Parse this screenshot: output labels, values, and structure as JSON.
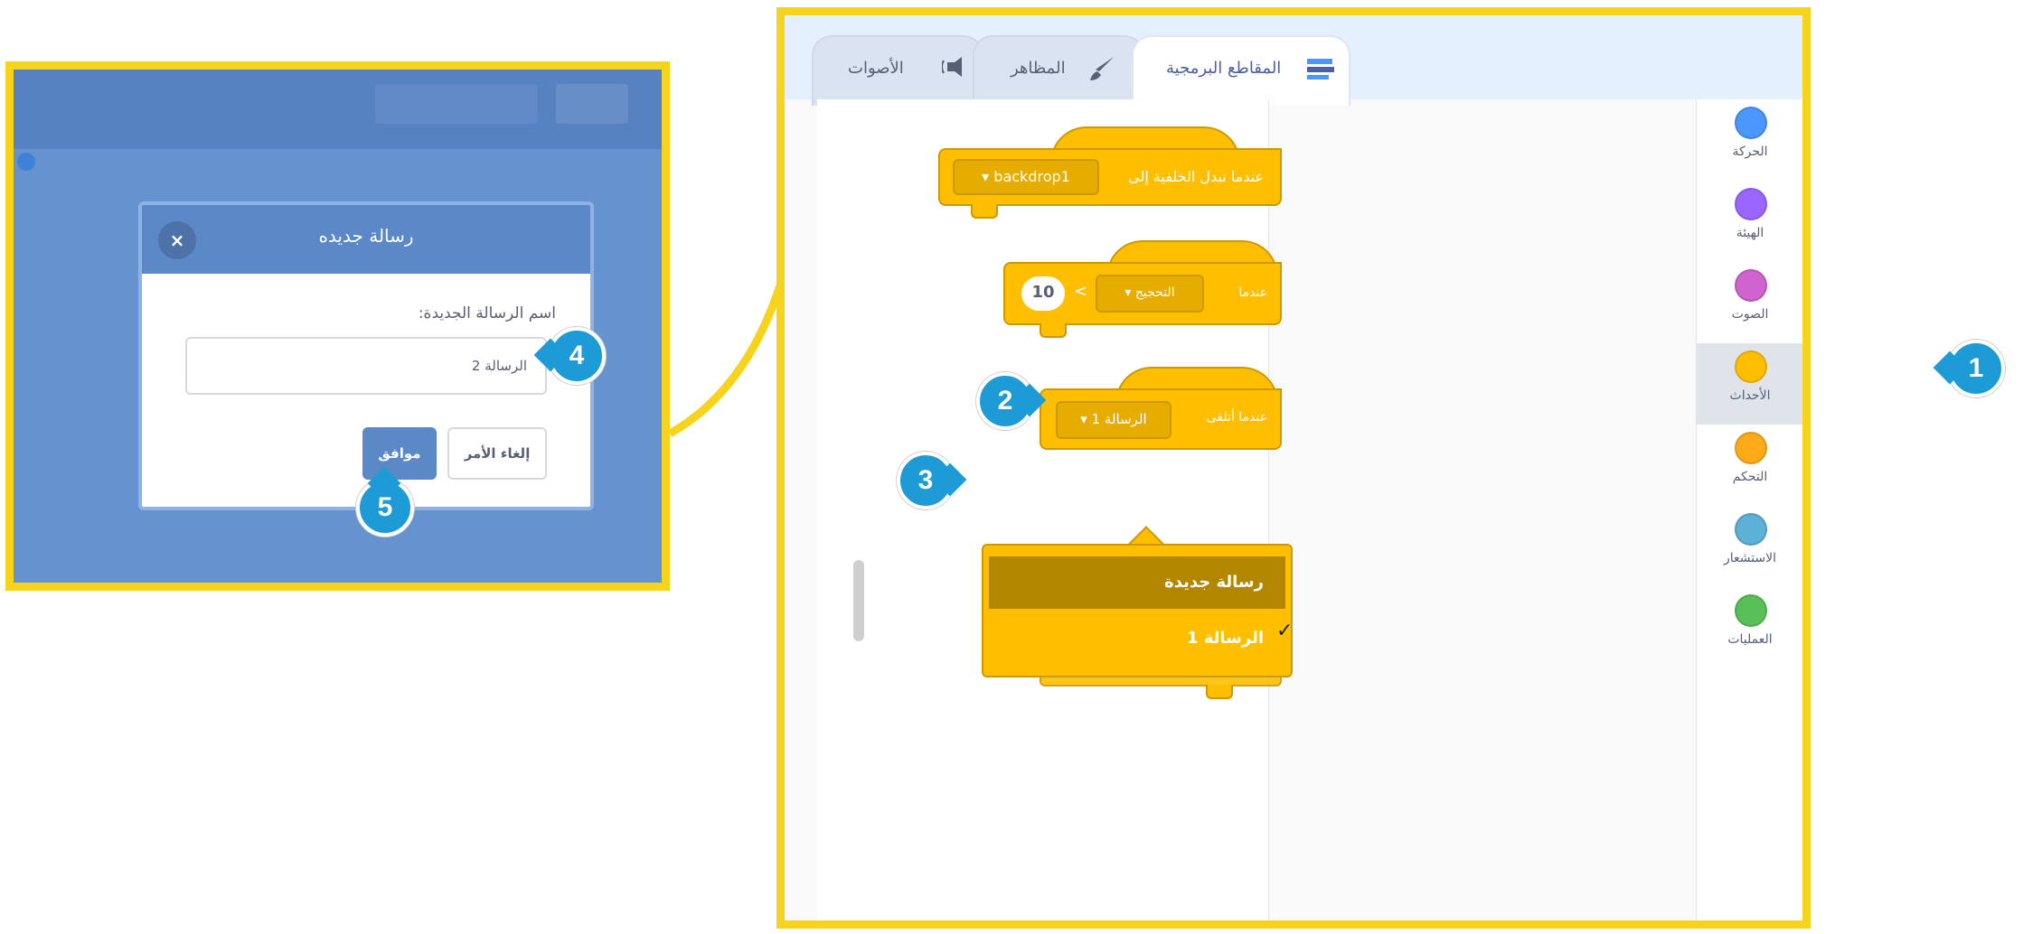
{
  "dialog": {
    "title": "رسالة جديده",
    "close_glyph": "×",
    "prompt_label": "اسم الرسالة الجديدة:",
    "input_value": "الرسالة 2",
    "ok_label": "موافق",
    "cancel_label": "إلغاء الأمر"
  },
  "tabs": {
    "code": "المقاطع البرمجية",
    "costumes": "المظاهر",
    "sounds": "الأصوات"
  },
  "categories": [
    {
      "label": "الحركة",
      "color": "#4c97ff"
    },
    {
      "label": "الهيئة",
      "color": "#9966ff"
    },
    {
      "label": "الصوت",
      "color": "#cf63cf"
    },
    {
      "label": "الأحداث",
      "color": "#ffbf00"
    },
    {
      "label": "التحكم",
      "color": "#ffab19"
    },
    {
      "label": "الاستشعار",
      "color": "#5cb1d6"
    },
    {
      "label": "العمليات",
      "color": "#59c059"
    }
  ],
  "selected_category": "الأحداث",
  "blocks": {
    "backdrop": {
      "text": "عندما تبدل الخلفية إلى",
      "dropdown": "backdrop1"
    },
    "greater": {
      "text": "عندما",
      "dropdown": "التحجيج",
      "operator": ">",
      "value": "10"
    },
    "receive": {
      "text": "عندما أتلقى",
      "dropdown": "الرسالة 1"
    }
  },
  "dropdown_menu": {
    "items": [
      "رسالة جديدة",
      "الرسالة 1"
    ],
    "checked_item": "الرسالة 1",
    "check_glyph": "✓"
  },
  "callouts": [
    "1",
    "2",
    "3",
    "4",
    "5"
  ],
  "colors": {
    "highlight_border": "#f8d31e",
    "callout": "#1d9bd7",
    "events_block": "#ffbf00",
    "dialog_header": "#5b88c7"
  }
}
